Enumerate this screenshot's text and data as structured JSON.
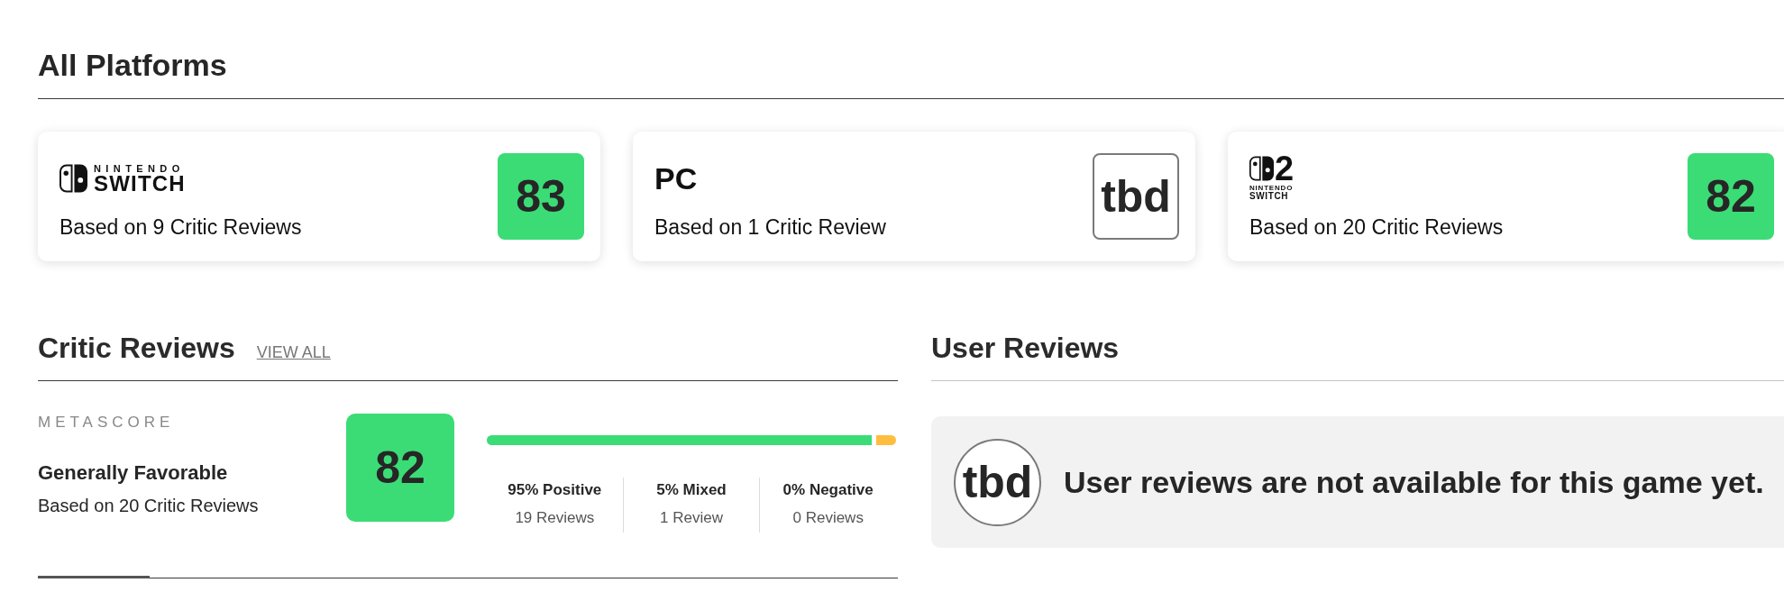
{
  "all_platforms": {
    "title": "All Platforms",
    "cards": [
      {
        "platform": {
          "kind": "switch",
          "small": "NINTENDO",
          "large": "SWITCH"
        },
        "summary": "Based on 9 Critic Reviews",
        "score": {
          "kind": "favorable",
          "value": "83"
        }
      },
      {
        "platform": {
          "kind": "name",
          "name": "PC"
        },
        "summary": "Based on 1 Critic Review",
        "score": {
          "kind": "tbd",
          "value": "tbd"
        }
      },
      {
        "platform": {
          "kind": "switch2",
          "mark": "2",
          "small": "NINTENDO",
          "large": "SWITCH"
        },
        "summary": "Based on 20 Critic Reviews",
        "score": {
          "kind": "favorable",
          "value": "82"
        }
      }
    ]
  },
  "critic_reviews": {
    "title": "Critic Reviews",
    "link": "VIEW ALL",
    "label": "METASCORE",
    "verdict": "Generally Favorable",
    "summary": "Based on 20 Critic Reviews",
    "score": {
      "kind": "favorable",
      "value": "82"
    },
    "distribution": [
      {
        "kind": "positive",
        "level": 0.95,
        "label": "95% Positive",
        "count": "19 Reviews"
      },
      {
        "kind": "mixed",
        "level": 0.05,
        "label": "5% Mixed",
        "count": "1 Review"
      },
      {
        "kind": "negative",
        "label": "0% Negative",
        "count": "0 Reviews"
      }
    ]
  },
  "user_reviews": {
    "title": "User Reviews",
    "score": {
      "kind": "tbd",
      "value": "tbd"
    },
    "message": "User reviews are not available for this game yet."
  }
}
